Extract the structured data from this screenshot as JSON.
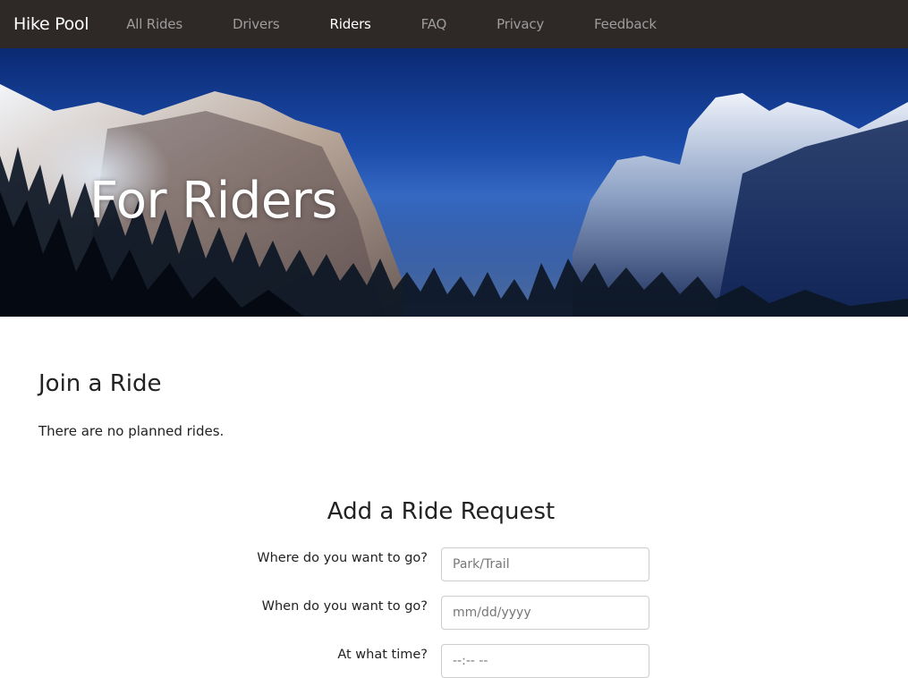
{
  "navbar": {
    "brand": "Hike Pool",
    "items": [
      {
        "label": "All Rides",
        "active": false
      },
      {
        "label": "Drivers",
        "active": false
      },
      {
        "label": "Riders",
        "active": true
      },
      {
        "label": "FAQ",
        "active": false
      },
      {
        "label": "Privacy",
        "active": false
      },
      {
        "label": "Feedback",
        "active": false
      }
    ]
  },
  "hero": {
    "title": "For Riders"
  },
  "join": {
    "title": "Join a Ride",
    "empty_text": "There are no planned rides."
  },
  "request_form": {
    "title": "Add a Ride Request",
    "fields": [
      {
        "label": "Where do you want to go?",
        "placeholder": "Park/Trail",
        "value": ""
      },
      {
        "label": "When do you want to go?",
        "placeholder": "mm/dd/yyyy",
        "value": ""
      },
      {
        "label": "At what time?",
        "placeholder": "--:-- --",
        "value": ""
      }
    ]
  },
  "colors": {
    "navbar_bg": "#2e2826",
    "nav_active": "#ffffff",
    "nav_inactive": "#9d9d9d"
  }
}
